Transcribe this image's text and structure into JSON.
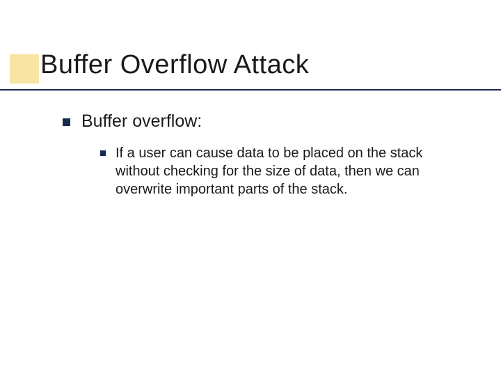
{
  "title": "Buffer Overflow Attack",
  "bullets": {
    "lvl1": {
      "text": "Buffer overflow:"
    },
    "lvl2": {
      "text": "If a user can cause data to be placed on the stack without checking for the size of data, then we can overwrite important parts of the stack."
    }
  }
}
